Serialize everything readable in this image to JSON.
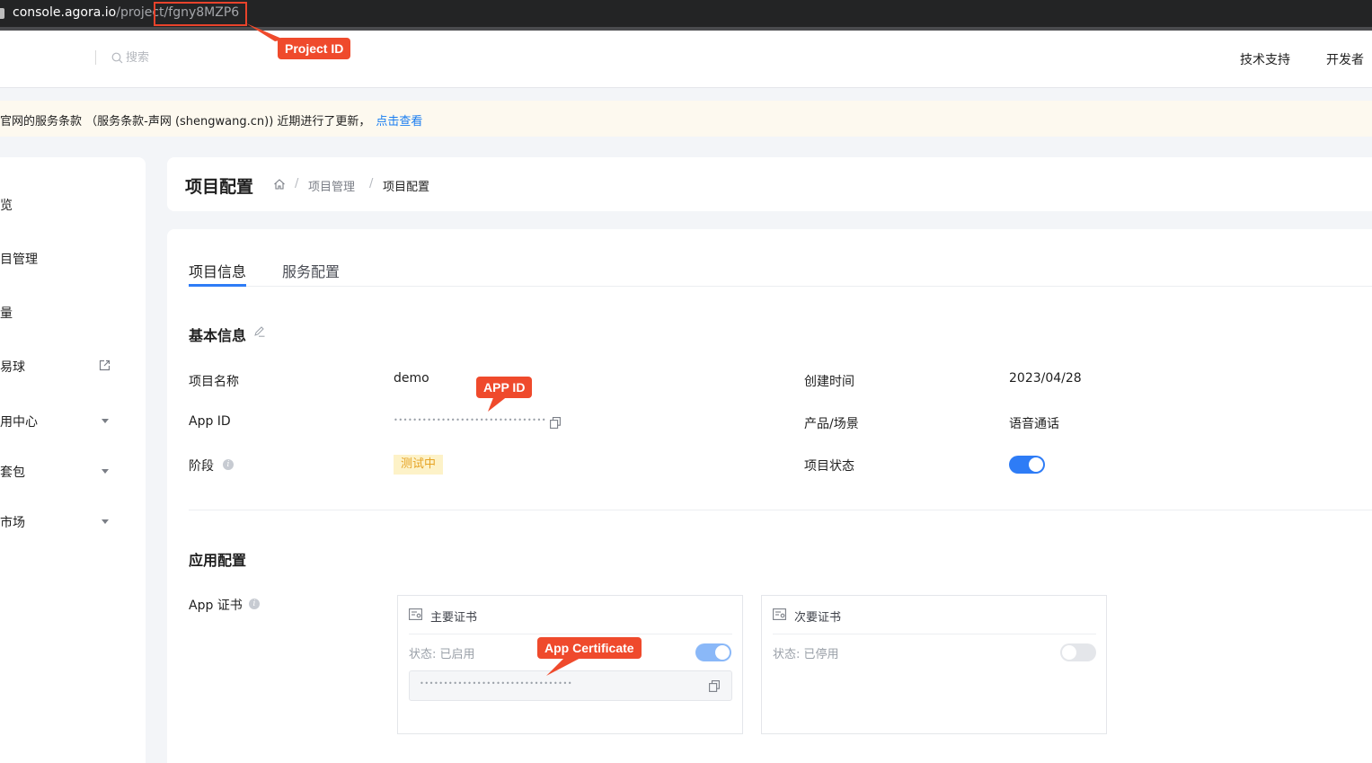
{
  "browser": {
    "url_host": "console.agora.io",
    "url_path": "/project/",
    "url_id": "fgny8MZP6"
  },
  "header": {
    "search_placeholder": "搜索",
    "links": [
      "技术支持",
      "开发者"
    ]
  },
  "notice": {
    "text": "官网的服务条款 （服务条款-声网 (shengwang.cn)) 近期进行了更新，",
    "link_label": "点击查看"
  },
  "sidebar": {
    "items": [
      {
        "label": "览",
        "icon": null
      },
      {
        "label": "目管理",
        "icon": null
      },
      {
        "label": "量",
        "icon": null
      },
      {
        "label": "易球",
        "icon": "external-link-icon"
      },
      {
        "label": "用中心",
        "icon": "chevron-down-icon"
      },
      {
        "label": "套包",
        "icon": "chevron-down-icon"
      },
      {
        "label": "市场",
        "icon": "chevron-down-icon"
      }
    ]
  },
  "page": {
    "title": "项目配置",
    "breadcrumb": [
      "项目管理",
      "项目配置"
    ],
    "breadcrumb_separator": "/"
  },
  "tabs": [
    {
      "label": "项目信息",
      "active": true
    },
    {
      "label": "服务配置",
      "active": false
    }
  ],
  "basic_info": {
    "title": "基本信息",
    "name_label": "项目名称",
    "name_value": "demo",
    "created_label": "创建时间",
    "created_value": "2023/04/28",
    "appid_label": "App ID",
    "appid_masked": "••••••••••••••••••••••••••••••••",
    "product_label": "产品/场景",
    "product_value": "语音通话",
    "stage_label": "阶段",
    "stage_value": "测试中",
    "status_label": "项目状态",
    "status_on": true
  },
  "app_config": {
    "title": "应用配置",
    "cert_label": "App 证书",
    "primary": {
      "title": "主要证书",
      "status": "状态: 已启用",
      "enabled": true,
      "masked": "••••••••••••••••••••••••••••••••"
    },
    "secondary": {
      "title": "次要证书",
      "status": "状态: 已停用",
      "enabled": false
    }
  },
  "annotations": {
    "project_id": "Project ID",
    "app_id": "APP ID",
    "app_certificate": "App Certificate"
  },
  "colors": {
    "accent": "#2e7cf6",
    "callout": "#ef4a2c",
    "badge_bg": "#fdf2c8",
    "badge_text": "#e6a324",
    "notice_bg": "#fdf9ef"
  }
}
